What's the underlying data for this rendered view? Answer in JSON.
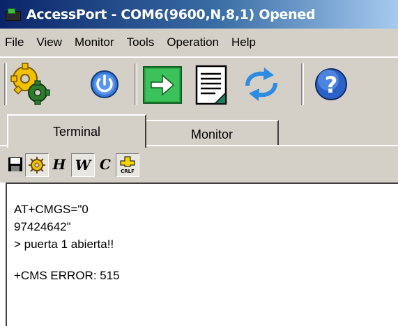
{
  "window": {
    "title": "AccessPort - COM6(9600,N,8,1) Opened"
  },
  "menu": [
    "File",
    "View",
    "Monitor",
    "Tools",
    "Operation",
    "Help"
  ],
  "toolbar": {
    "buttons": [
      "settings-gear-icon",
      "power-icon",
      "send-arrow-icon",
      "document-icon",
      "refresh-arrows-icon",
      "help-icon"
    ]
  },
  "tabs": {
    "terminal": "Terminal",
    "monitor": "Monitor"
  },
  "subtoolbar": {
    "h_label": "H",
    "w_label": "W",
    "c_label": "C",
    "crlf_label": "CRLF"
  },
  "terminal": {
    "lines": [
      "AT+CMGS=\"0",
      "97424642\"",
      "> puerta 1 abierta!!",
      "",
      "+CMS ERROR: 515"
    ]
  },
  "colors": {
    "titlebar_start": "#0a246a",
    "titlebar_end": "#a6caf0",
    "chrome": "#d4d0c8"
  }
}
